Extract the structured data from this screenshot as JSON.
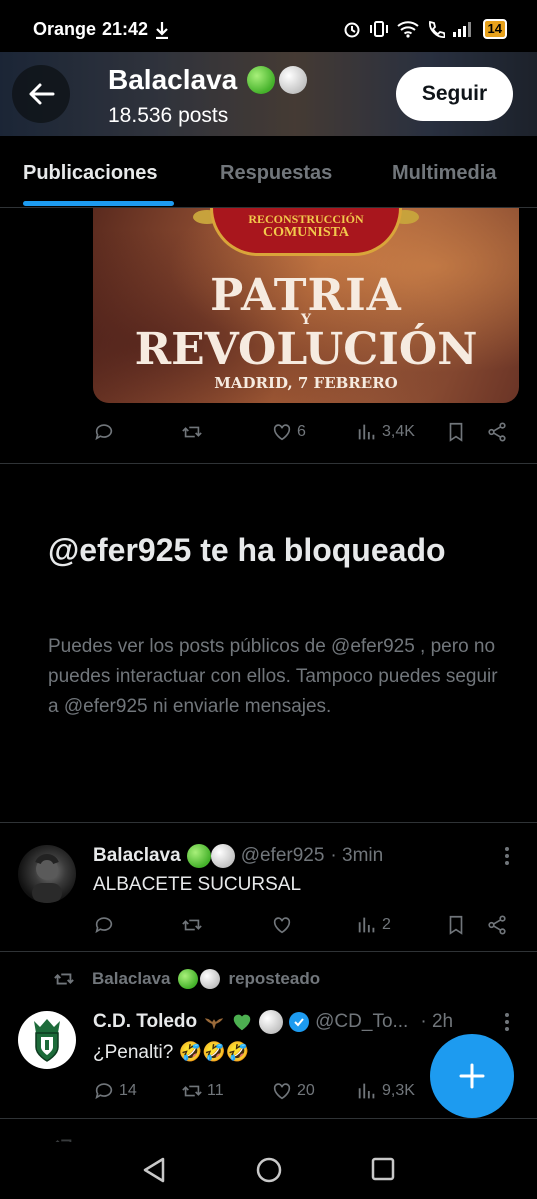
{
  "status_bar": {
    "carrier": "Orange",
    "time": "21:42",
    "battery": "14"
  },
  "header": {
    "title": "Balaclava",
    "posts_count": "18.536 posts",
    "follow_label": "Seguir"
  },
  "tabs": [
    {
      "label": "Publicaciones",
      "active": true
    },
    {
      "label": "Respuestas",
      "active": false
    },
    {
      "label": "Multimedia",
      "active": false
    }
  ],
  "promo_image": {
    "banner_line1": "RECONSTRUCCIÓN",
    "banner_line2": "COMUNISTA",
    "line1": "PATRIA",
    "line_y": "Y",
    "line2": "REVOLUCIÓN",
    "line3": "MADRID, 7 FEBRERO"
  },
  "post1_actions": {
    "likes": "6",
    "views": "3,4K"
  },
  "blocked": {
    "title": "@efer925 te ha bloqueado",
    "body": "Puedes ver los posts públicos de @efer925 , pero no puedes interactuar con ellos. Tampoco puedes seguir a @efer925 ni enviarle mensajes."
  },
  "tweet1": {
    "name": "Balaclava",
    "handle": "@efer925",
    "time": "· 3min",
    "text": "ALBACETE SUCURSAL",
    "views": "2"
  },
  "tweet2": {
    "repost_label": "Balaclava",
    "repost_suffix": "reposteado",
    "name": "C.D. Toledo",
    "handle": "@CD_To...",
    "time": "· 2h",
    "text": "¿Penalti? 🤣🤣🤣",
    "replies": "14",
    "reposts": "11",
    "likes": "20",
    "views": "9,3K"
  },
  "colors": {
    "accent": "#1d9bf0",
    "muted": "#71767b",
    "text": "#e7e9ea",
    "divider": "#2f3336"
  }
}
